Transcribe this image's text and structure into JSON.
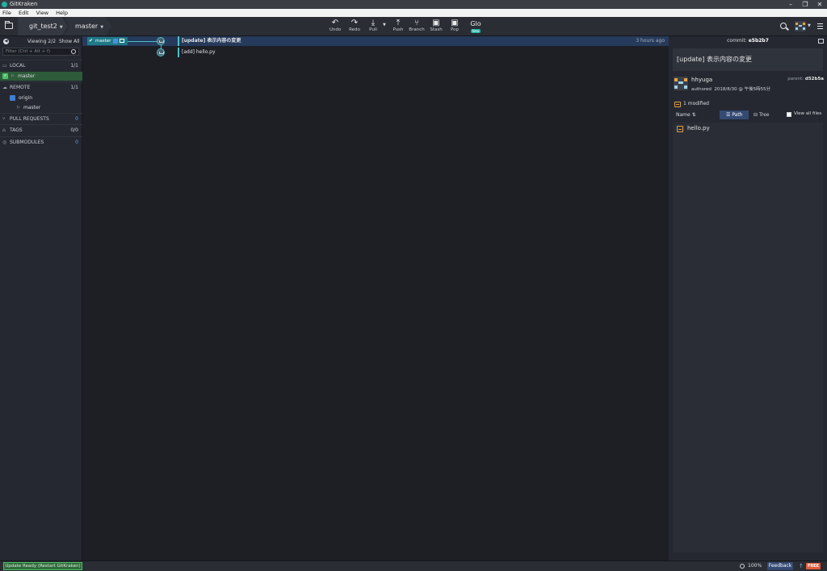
{
  "window": {
    "title": "GitKraken"
  },
  "menu": [
    "File",
    "Edit",
    "View",
    "Help"
  ],
  "toolbar": {
    "repo": "git_test2",
    "branch": "master",
    "actions": [
      {
        "label": "Undo",
        "glyph": "↶"
      },
      {
        "label": "Redo",
        "glyph": "↷"
      },
      {
        "label": "Pull",
        "glyph": "⤓"
      },
      {
        "label": "Push",
        "glyph": "⤒"
      },
      {
        "label": "Branch",
        "glyph": "⑂"
      },
      {
        "label": "Stash",
        "glyph": "▣"
      },
      {
        "label": "Pop",
        "glyph": "▣"
      }
    ],
    "glo": {
      "label": "Glo",
      "badge": "New"
    }
  },
  "sidebar": {
    "viewing": "Viewing 2/2",
    "show_all": "Show All",
    "filter_placeholder": "Filter (Ctrl + Alt + f)",
    "local": {
      "label": "LOCAL",
      "count": "1/1",
      "branches": [
        "master"
      ]
    },
    "remote": {
      "label": "REMOTE",
      "count": "1/1",
      "name": "origin",
      "branches": [
        "master"
      ]
    },
    "pull_requests": {
      "label": "PULL REQUESTS",
      "count": "0"
    },
    "tags": {
      "label": "TAGS",
      "count": "0/0"
    },
    "submodules": {
      "label": "SUBMODULES",
      "count": "0"
    }
  },
  "graph": {
    "branch_tag": "master",
    "commits": [
      {
        "message": "[update] 表示内容の変更",
        "time": "3 hours ago"
      },
      {
        "message": "[add] hello.py",
        "time": ""
      }
    ]
  },
  "detail": {
    "commit_label": "commit:",
    "commit_sha": "e5b2b7",
    "message": "[update] 表示内容の変更",
    "author": "hhyuga",
    "authored_label": "authored",
    "authored_date": "2018/8/30 @ 午後5時55分",
    "parent_label": "parent:",
    "parent_sha": "d52b5a",
    "modified": "1 modified",
    "name_label": "Name",
    "path_label": "Path",
    "tree_label": "Tree",
    "view_all_files": "View all files",
    "files": [
      "hello.py"
    ]
  },
  "status": {
    "update": "Update Ready (Restart GitKraken)",
    "zoom": "100%",
    "feedback": "Feedback",
    "free": "FREE"
  }
}
